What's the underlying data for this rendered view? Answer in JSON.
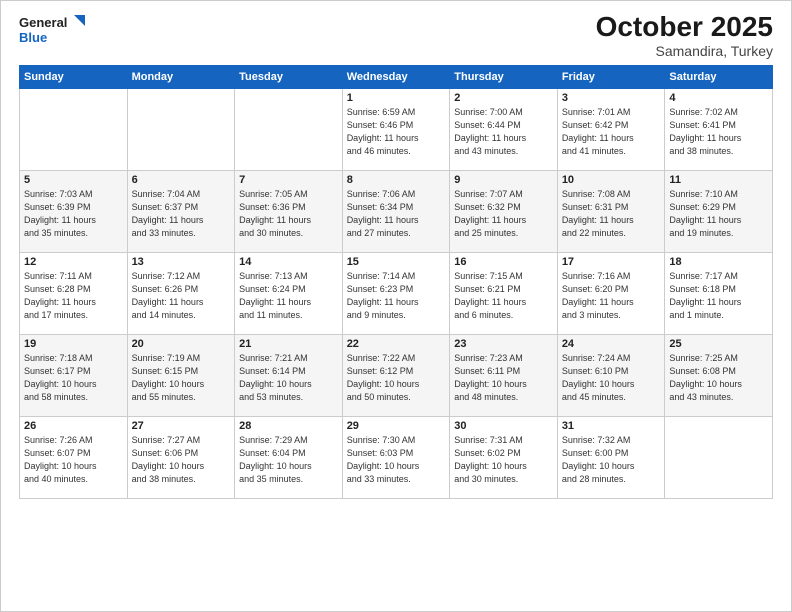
{
  "header": {
    "logo_line1": "General",
    "logo_line2": "Blue",
    "month": "October 2025",
    "location": "Samandira, Turkey"
  },
  "days_of_week": [
    "Sunday",
    "Monday",
    "Tuesday",
    "Wednesday",
    "Thursday",
    "Friday",
    "Saturday"
  ],
  "weeks": [
    [
      {
        "day": "",
        "info": ""
      },
      {
        "day": "",
        "info": ""
      },
      {
        "day": "",
        "info": ""
      },
      {
        "day": "1",
        "info": "Sunrise: 6:59 AM\nSunset: 6:46 PM\nDaylight: 11 hours\nand 46 minutes."
      },
      {
        "day": "2",
        "info": "Sunrise: 7:00 AM\nSunset: 6:44 PM\nDaylight: 11 hours\nand 43 minutes."
      },
      {
        "day": "3",
        "info": "Sunrise: 7:01 AM\nSunset: 6:42 PM\nDaylight: 11 hours\nand 41 minutes."
      },
      {
        "day": "4",
        "info": "Sunrise: 7:02 AM\nSunset: 6:41 PM\nDaylight: 11 hours\nand 38 minutes."
      }
    ],
    [
      {
        "day": "5",
        "info": "Sunrise: 7:03 AM\nSunset: 6:39 PM\nDaylight: 11 hours\nand 35 minutes."
      },
      {
        "day": "6",
        "info": "Sunrise: 7:04 AM\nSunset: 6:37 PM\nDaylight: 11 hours\nand 33 minutes."
      },
      {
        "day": "7",
        "info": "Sunrise: 7:05 AM\nSunset: 6:36 PM\nDaylight: 11 hours\nand 30 minutes."
      },
      {
        "day": "8",
        "info": "Sunrise: 7:06 AM\nSunset: 6:34 PM\nDaylight: 11 hours\nand 27 minutes."
      },
      {
        "day": "9",
        "info": "Sunrise: 7:07 AM\nSunset: 6:32 PM\nDaylight: 11 hours\nand 25 minutes."
      },
      {
        "day": "10",
        "info": "Sunrise: 7:08 AM\nSunset: 6:31 PM\nDaylight: 11 hours\nand 22 minutes."
      },
      {
        "day": "11",
        "info": "Sunrise: 7:10 AM\nSunset: 6:29 PM\nDaylight: 11 hours\nand 19 minutes."
      }
    ],
    [
      {
        "day": "12",
        "info": "Sunrise: 7:11 AM\nSunset: 6:28 PM\nDaylight: 11 hours\nand 17 minutes."
      },
      {
        "day": "13",
        "info": "Sunrise: 7:12 AM\nSunset: 6:26 PM\nDaylight: 11 hours\nand 14 minutes."
      },
      {
        "day": "14",
        "info": "Sunrise: 7:13 AM\nSunset: 6:24 PM\nDaylight: 11 hours\nand 11 minutes."
      },
      {
        "day": "15",
        "info": "Sunrise: 7:14 AM\nSunset: 6:23 PM\nDaylight: 11 hours\nand 9 minutes."
      },
      {
        "day": "16",
        "info": "Sunrise: 7:15 AM\nSunset: 6:21 PM\nDaylight: 11 hours\nand 6 minutes."
      },
      {
        "day": "17",
        "info": "Sunrise: 7:16 AM\nSunset: 6:20 PM\nDaylight: 11 hours\nand 3 minutes."
      },
      {
        "day": "18",
        "info": "Sunrise: 7:17 AM\nSunset: 6:18 PM\nDaylight: 11 hours\nand 1 minute."
      }
    ],
    [
      {
        "day": "19",
        "info": "Sunrise: 7:18 AM\nSunset: 6:17 PM\nDaylight: 10 hours\nand 58 minutes."
      },
      {
        "day": "20",
        "info": "Sunrise: 7:19 AM\nSunset: 6:15 PM\nDaylight: 10 hours\nand 55 minutes."
      },
      {
        "day": "21",
        "info": "Sunrise: 7:21 AM\nSunset: 6:14 PM\nDaylight: 10 hours\nand 53 minutes."
      },
      {
        "day": "22",
        "info": "Sunrise: 7:22 AM\nSunset: 6:12 PM\nDaylight: 10 hours\nand 50 minutes."
      },
      {
        "day": "23",
        "info": "Sunrise: 7:23 AM\nSunset: 6:11 PM\nDaylight: 10 hours\nand 48 minutes."
      },
      {
        "day": "24",
        "info": "Sunrise: 7:24 AM\nSunset: 6:10 PM\nDaylight: 10 hours\nand 45 minutes."
      },
      {
        "day": "25",
        "info": "Sunrise: 7:25 AM\nSunset: 6:08 PM\nDaylight: 10 hours\nand 43 minutes."
      }
    ],
    [
      {
        "day": "26",
        "info": "Sunrise: 7:26 AM\nSunset: 6:07 PM\nDaylight: 10 hours\nand 40 minutes."
      },
      {
        "day": "27",
        "info": "Sunrise: 7:27 AM\nSunset: 6:06 PM\nDaylight: 10 hours\nand 38 minutes."
      },
      {
        "day": "28",
        "info": "Sunrise: 7:29 AM\nSunset: 6:04 PM\nDaylight: 10 hours\nand 35 minutes."
      },
      {
        "day": "29",
        "info": "Sunrise: 7:30 AM\nSunset: 6:03 PM\nDaylight: 10 hours\nand 33 minutes."
      },
      {
        "day": "30",
        "info": "Sunrise: 7:31 AM\nSunset: 6:02 PM\nDaylight: 10 hours\nand 30 minutes."
      },
      {
        "day": "31",
        "info": "Sunrise: 7:32 AM\nSunset: 6:00 PM\nDaylight: 10 hours\nand 28 minutes."
      },
      {
        "day": "",
        "info": ""
      }
    ]
  ]
}
